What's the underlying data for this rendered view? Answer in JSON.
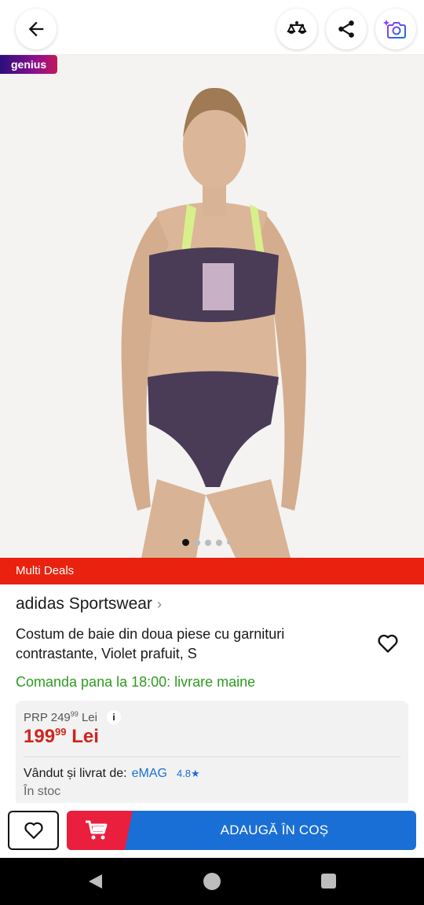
{
  "header": {
    "back_icon": "arrow-left-icon",
    "compare_icon": "scale-icon",
    "share_icon": "share-icon",
    "camera_icon": "camera-sparkle-icon"
  },
  "badge": {
    "label": "genius"
  },
  "gallery": {
    "image_count": 5,
    "active_index": 0
  },
  "deals": {
    "label": "Multi Deals"
  },
  "product": {
    "brand": "adidas Sportswear",
    "brand_chevron": "›",
    "title": "Costum de baie din doua piese cu garnituri contrastante, Violet prafuit, S",
    "favorite_icon": "heart-outline-icon",
    "delivery": "Comanda pana la 18:00: livrare maine"
  },
  "pricing": {
    "prp_prefix": "PRP 249",
    "prp_decimals": "99",
    "prp_currency": "Lei",
    "info": "i",
    "price_int": "199",
    "price_decimals": "99",
    "price_currency": "Lei"
  },
  "seller": {
    "label": "Vândut și livrat de:",
    "name": "eMAG",
    "rating": "4.8",
    "rating_star": "★",
    "stock": "În stoc"
  },
  "actions": {
    "add_to_cart": "ADAUGĂ ÎN COȘ"
  },
  "colors": {
    "accent_blue": "#1a6fd6",
    "cart_red": "#ea1f3d",
    "deals_red": "#e8220f",
    "price_red": "#d0241c",
    "delivery_green": "#2e9b1f"
  }
}
